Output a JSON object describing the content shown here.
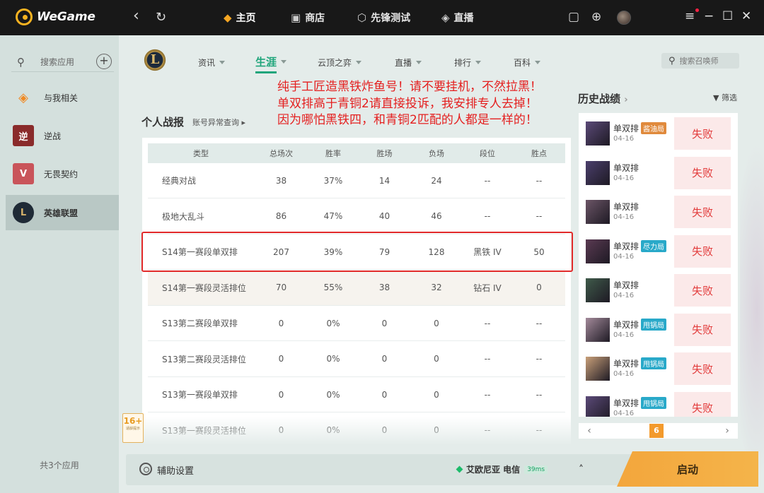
{
  "topbar": {
    "app_name": "WeGame",
    "back_icon": "‹",
    "refresh_icon": "↻",
    "tabs": [
      {
        "label": "主页",
        "icon": "game-controller-icon"
      },
      {
        "label": "商店",
        "icon": "shop-icon"
      },
      {
        "label": "先锋测试",
        "icon": "flask-icon"
      },
      {
        "label": "直播",
        "icon": "live-icon"
      }
    ],
    "right_icons": [
      "gift-icon",
      "download-icon",
      "avatar"
    ],
    "window_controls": [
      "≡",
      "−",
      "☐",
      "✕"
    ]
  },
  "sidebar": {
    "search_label": "搜索应用",
    "add_icon": "+",
    "items": [
      {
        "label": "与我相关",
        "icon": "wegame-icon"
      },
      {
        "label": "逆战",
        "icon": "nizhan-icon",
        "glyph": "逆"
      },
      {
        "label": "无畏契约",
        "icon": "valorant-icon",
        "glyph": "V"
      },
      {
        "label": "英雄联盟",
        "icon": "lol-icon",
        "glyph": "L"
      }
    ],
    "count": "共3个应用"
  },
  "game": {
    "logo_letter": "L",
    "subnav": [
      {
        "label": "资讯"
      },
      {
        "label": "生涯"
      },
      {
        "label": "云顶之弈"
      },
      {
        "label": "直播"
      },
      {
        "label": "排行"
      },
      {
        "label": "百科"
      }
    ],
    "search_placeholder": "搜索召唤师",
    "notice": [
      "纯手工匠造黑铁炸鱼号！请不要挂机，不然拉黑！",
      "单双排高于青铜2请直接投诉，我安排专人去掉！",
      "因为哪怕黑铁四，和青铜2匹配的人都是一样的！"
    ],
    "section_title": "个人战报",
    "section_link": "账号异常查询 ▸"
  },
  "stats": {
    "headers": [
      "类型",
      "总场次",
      "胜率",
      "胜场",
      "负场",
      "段位",
      "胜点"
    ],
    "rows": [
      [
        "经典对战",
        "38",
        "37%",
        "14",
        "24",
        "--",
        "--"
      ],
      [
        "极地大乱斗",
        "86",
        "47%",
        "40",
        "46",
        "--",
        "--"
      ],
      [
        "S14第一赛段单双排",
        "207",
        "39%",
        "79",
        "128",
        "黑铁 IV",
        "50"
      ],
      [
        "S14第一赛段灵活排位",
        "70",
        "55%",
        "38",
        "32",
        "钻石 IV",
        "0"
      ],
      [
        "S13第二赛段单双排",
        "0",
        "0%",
        "0",
        "0",
        "--",
        "--"
      ],
      [
        "S13第二赛段灵活排位",
        "0",
        "0%",
        "0",
        "0",
        "--",
        "--"
      ],
      [
        "S13第一赛段单双排",
        "0",
        "0%",
        "0",
        "0",
        "--",
        "--"
      ],
      [
        "S13第一赛段灵活排位",
        "0",
        "0%",
        "0",
        "0",
        "--",
        "--"
      ]
    ]
  },
  "age_rating": {
    "label": "16+",
    "sub": "适龄提示"
  },
  "history": {
    "title": "历史战绩",
    "filter": "筛选",
    "items": [
      {
        "mode": "单双排",
        "tag": "酱油局",
        "tag_color": "#e08a3c",
        "date": "04-16",
        "result": "失败"
      },
      {
        "mode": "单双排",
        "tag": "",
        "tag_color": "",
        "date": "04-16",
        "result": "失败"
      },
      {
        "mode": "单双排",
        "tag": "",
        "tag_color": "",
        "date": "04-16",
        "result": "失败"
      },
      {
        "mode": "单双排",
        "tag": "尽力局",
        "tag_color": "#29a9c9",
        "date": "04-16",
        "result": "失败"
      },
      {
        "mode": "单双排",
        "tag": "",
        "tag_color": "",
        "date": "04-16",
        "result": "失败"
      },
      {
        "mode": "单双排",
        "tag": "甩锅局",
        "tag_color": "#29a9c9",
        "date": "04-16",
        "result": "失败"
      },
      {
        "mode": "单双排",
        "tag": "甩锅局",
        "tag_color": "#29a9c9",
        "date": "04-16",
        "result": "失败"
      },
      {
        "mode": "单双排",
        "tag": "甩锅局",
        "tag_color": "#29a9c9",
        "date": "04-16",
        "result": "失败"
      }
    ],
    "page": "6",
    "prev": "‹",
    "next": "›"
  },
  "bottom": {
    "assist_label": "辅助设置",
    "server": "艾欧尼亚 电信",
    "ping": "39ms",
    "chevron": "˄",
    "launch_label": "启动"
  }
}
